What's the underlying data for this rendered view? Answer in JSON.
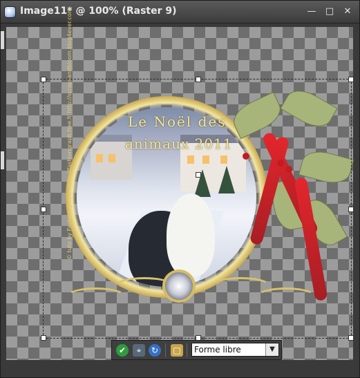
{
  "window": {
    "title": "Image11* @ 100% (Raster 9)",
    "app_icon": "psp-app-icon",
    "controls": [
      "minimize",
      "maximize",
      "close"
    ]
  },
  "canvas": {
    "background": "transparency-checkerboard",
    "card_text_line1": "Le Noël des",
    "card_text_line2": "animaux 2011",
    "credit_text": "© tuto by Fashion graph - http://fashiongraph.free.fr\nhttp://scrapsandbloom.blog4ever.com"
  },
  "toolbar": {
    "apply_label": "✔",
    "mode_value": "Forme libre",
    "options": [
      "Forme libre"
    ]
  },
  "colors": {
    "accent_gold": "#e1ce71",
    "ribbon_red": "#d8262d"
  }
}
